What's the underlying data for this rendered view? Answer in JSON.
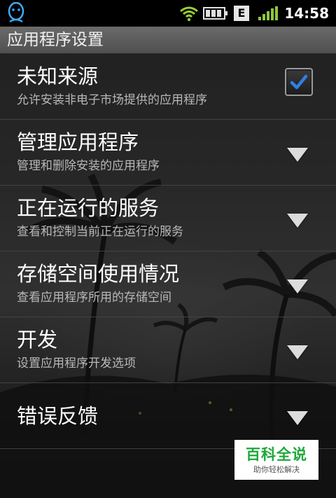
{
  "status_bar": {
    "time": "14:58",
    "network_type": "E",
    "icons": [
      "qq-penguin-icon",
      "wifi-icon",
      "battery-icon",
      "network-e-icon",
      "signal-bars-icon"
    ]
  },
  "title": "应用程序设置",
  "items": [
    {
      "label": "未知来源",
      "desc": "允许安装非电子市场提供的应用程序",
      "control": "checkbox",
      "checked": true
    },
    {
      "label": "管理应用程序",
      "desc": "管理和删除安装的应用程序",
      "control": "chevron"
    },
    {
      "label": "正在运行的服务",
      "desc": "查看和控制当前正在运行的服务",
      "control": "chevron"
    },
    {
      "label": "存储空间使用情况",
      "desc": "查看应用程序所用的存储空间",
      "control": "chevron"
    },
    {
      "label": "开发",
      "desc": "设置应用程序开发选项",
      "control": "chevron"
    },
    {
      "label": "错误反馈",
      "control": "chevron"
    }
  ],
  "watermark": {
    "main": "百科全说",
    "sub": "助你轻松解决"
  },
  "colors": {
    "checkbox_check": "#2f7fe6",
    "wifi": "#9acd32",
    "signal": "#8cc63f",
    "watermark_green": "#1ea83a"
  }
}
